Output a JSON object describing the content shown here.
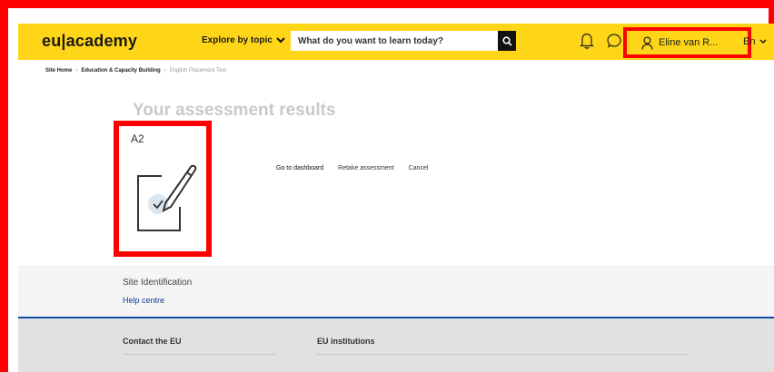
{
  "header": {
    "logo": "eu|academy",
    "explore_label": "Explore by topic",
    "search_placeholder": "What do you want to learn today?",
    "user_name": "Eline van R...",
    "language": "En"
  },
  "breadcrumb": {
    "items": [
      "Site Home",
      "Education & Capacity Building"
    ],
    "current": "English Placement Test"
  },
  "main": {
    "title": "Your assessment results",
    "level": "A2",
    "actions": [
      "Go to dashboard",
      "Retake assessment",
      "Cancel"
    ]
  },
  "footer": {
    "site_identification": "Site Identification",
    "help": "Help centre",
    "columns": [
      "Contact the EU",
      "EU institutions"
    ]
  },
  "colors": {
    "brand_yellow": "#ffd617",
    "annotation_red": "#ff0000",
    "footer_blue": "#0b4ea2"
  }
}
